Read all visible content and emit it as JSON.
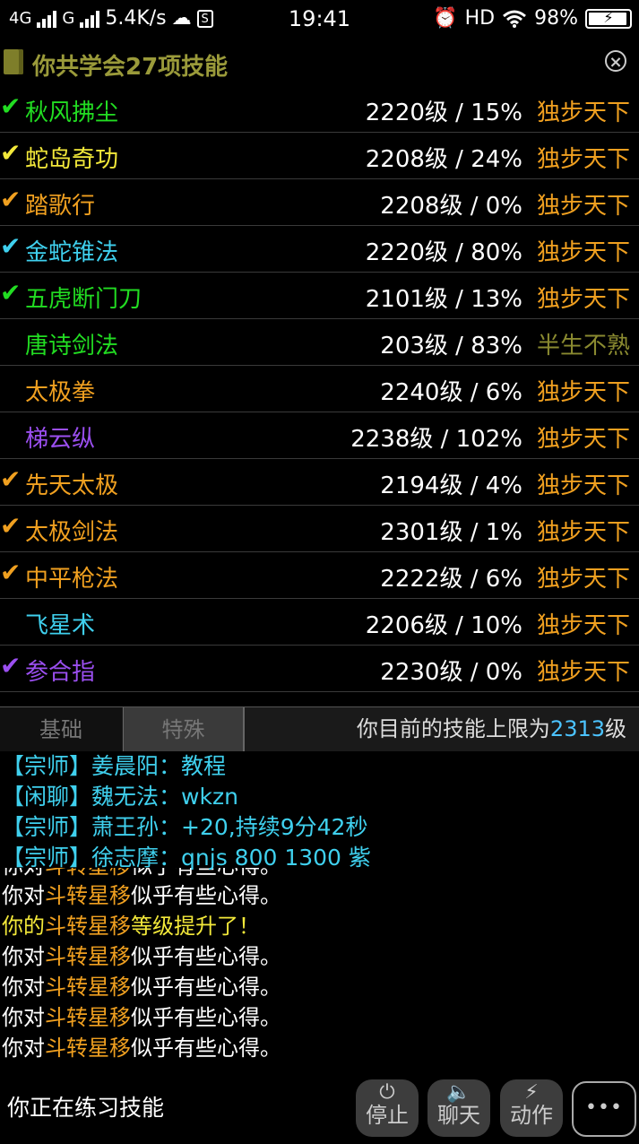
{
  "status_bar": {
    "network1": "4G",
    "network2": "G",
    "speed": "5.4K/s",
    "time": "19:41",
    "hd": "HD",
    "battery": "98%"
  },
  "header": {
    "title": "你共学会27项技能"
  },
  "skills": [
    {
      "check": "✔",
      "check_color": "#22dd22",
      "name": "秋风拂尘",
      "name_color": "#22dd22",
      "level": "2220级 / 15%",
      "rank": "独步天下",
      "rank_color": "#f0a020"
    },
    {
      "check": "✔",
      "check_color": "#f3e93a",
      "name": "蛇岛奇功",
      "name_color": "#f3e93a",
      "level": "2208级 / 24%",
      "rank": "独步天下",
      "rank_color": "#f0a020"
    },
    {
      "check": "✔",
      "check_color": "#f0a020",
      "name": "踏歌行",
      "name_color": "#f0a020",
      "level": "2208级 / 0%",
      "rank": "独步天下",
      "rank_color": "#f0a020"
    },
    {
      "check": "✔",
      "check_color": "#3fd0ee",
      "name": "金蛇锥法",
      "name_color": "#3fd0ee",
      "level": "2220级 / 80%",
      "rank": "独步天下",
      "rank_color": "#f0a020"
    },
    {
      "check": "✔",
      "check_color": "#22dd22",
      "name": "五虎断门刀",
      "name_color": "#22dd22",
      "level": "2101级 / 13%",
      "rank": "独步天下",
      "rank_color": "#f0a020"
    },
    {
      "check": "",
      "check_color": "#22dd22",
      "name": "唐诗剑法",
      "name_color": "#22dd22",
      "level": "203级 / 83%",
      "rank": "半生不熟",
      "rank_color": "#8a8a30"
    },
    {
      "check": "",
      "check_color": "#f0a020",
      "name": "太极拳",
      "name_color": "#f0a020",
      "level": "2240级 / 6%",
      "rank": "独步天下",
      "rank_color": "#f0a020"
    },
    {
      "check": "",
      "check_color": "#9b4ff0",
      "name": "梯云纵",
      "name_color": "#9b4ff0",
      "level": "2238级 / 102%",
      "rank": "独步天下",
      "rank_color": "#f0a020"
    },
    {
      "check": "✔",
      "check_color": "#f0a020",
      "name": "先天太极",
      "name_color": "#f0a020",
      "level": "2194级 / 4%",
      "rank": "独步天下",
      "rank_color": "#f0a020"
    },
    {
      "check": "✔",
      "check_color": "#f0a020",
      "name": "太极剑法",
      "name_color": "#f0a020",
      "level": "2301级 / 1%",
      "rank": "独步天下",
      "rank_color": "#f0a020"
    },
    {
      "check": "✔",
      "check_color": "#f0a020",
      "name": "中平枪法",
      "name_color": "#f0a020",
      "level": "2222级 / 6%",
      "rank": "独步天下",
      "rank_color": "#f0a020"
    },
    {
      "check": "",
      "check_color": "#3fd0ee",
      "name": "飞星术",
      "name_color": "#3fd0ee",
      "level": "2206级 / 10%",
      "rank": "独步天下",
      "rank_color": "#f0a020"
    },
    {
      "check": "✔",
      "check_color": "#9b4ff0",
      "name": "参合指",
      "name_color": "#9b4ff0",
      "level": "2230级 / 0%",
      "rank": "独步天下",
      "rank_color": "#f0a020"
    }
  ],
  "tabs": {
    "basic": "基础",
    "special": "特殊",
    "limit_prefix": "你目前的技能上限为",
    "limit_value": "2313",
    "limit_suffix": "级"
  },
  "chat": [
    {
      "tag": "【宗师】",
      "name": "姜晨阳：",
      "msg": "教程"
    },
    {
      "tag": "【闲聊】",
      "name": "魏无法：",
      "msg": "wkzn"
    },
    {
      "tag": "【宗师】",
      "name": "萧王孙：",
      "msg": "+20,持续9分42秒"
    },
    {
      "tag": "【宗师】",
      "name": "徐志摩：",
      "msg": "qnjs 800 1300 紫"
    }
  ],
  "log": {
    "prefix": "你对",
    "skill": "斗转星移",
    "suffix": "似乎有些心得。",
    "levelup_prefix": "你的",
    "levelup_suffix": "等级提升了！"
  },
  "bottom": {
    "status": "你正在练习技能",
    "stop": "停止",
    "chat": "聊天",
    "action": "动作",
    "more": "•••"
  }
}
